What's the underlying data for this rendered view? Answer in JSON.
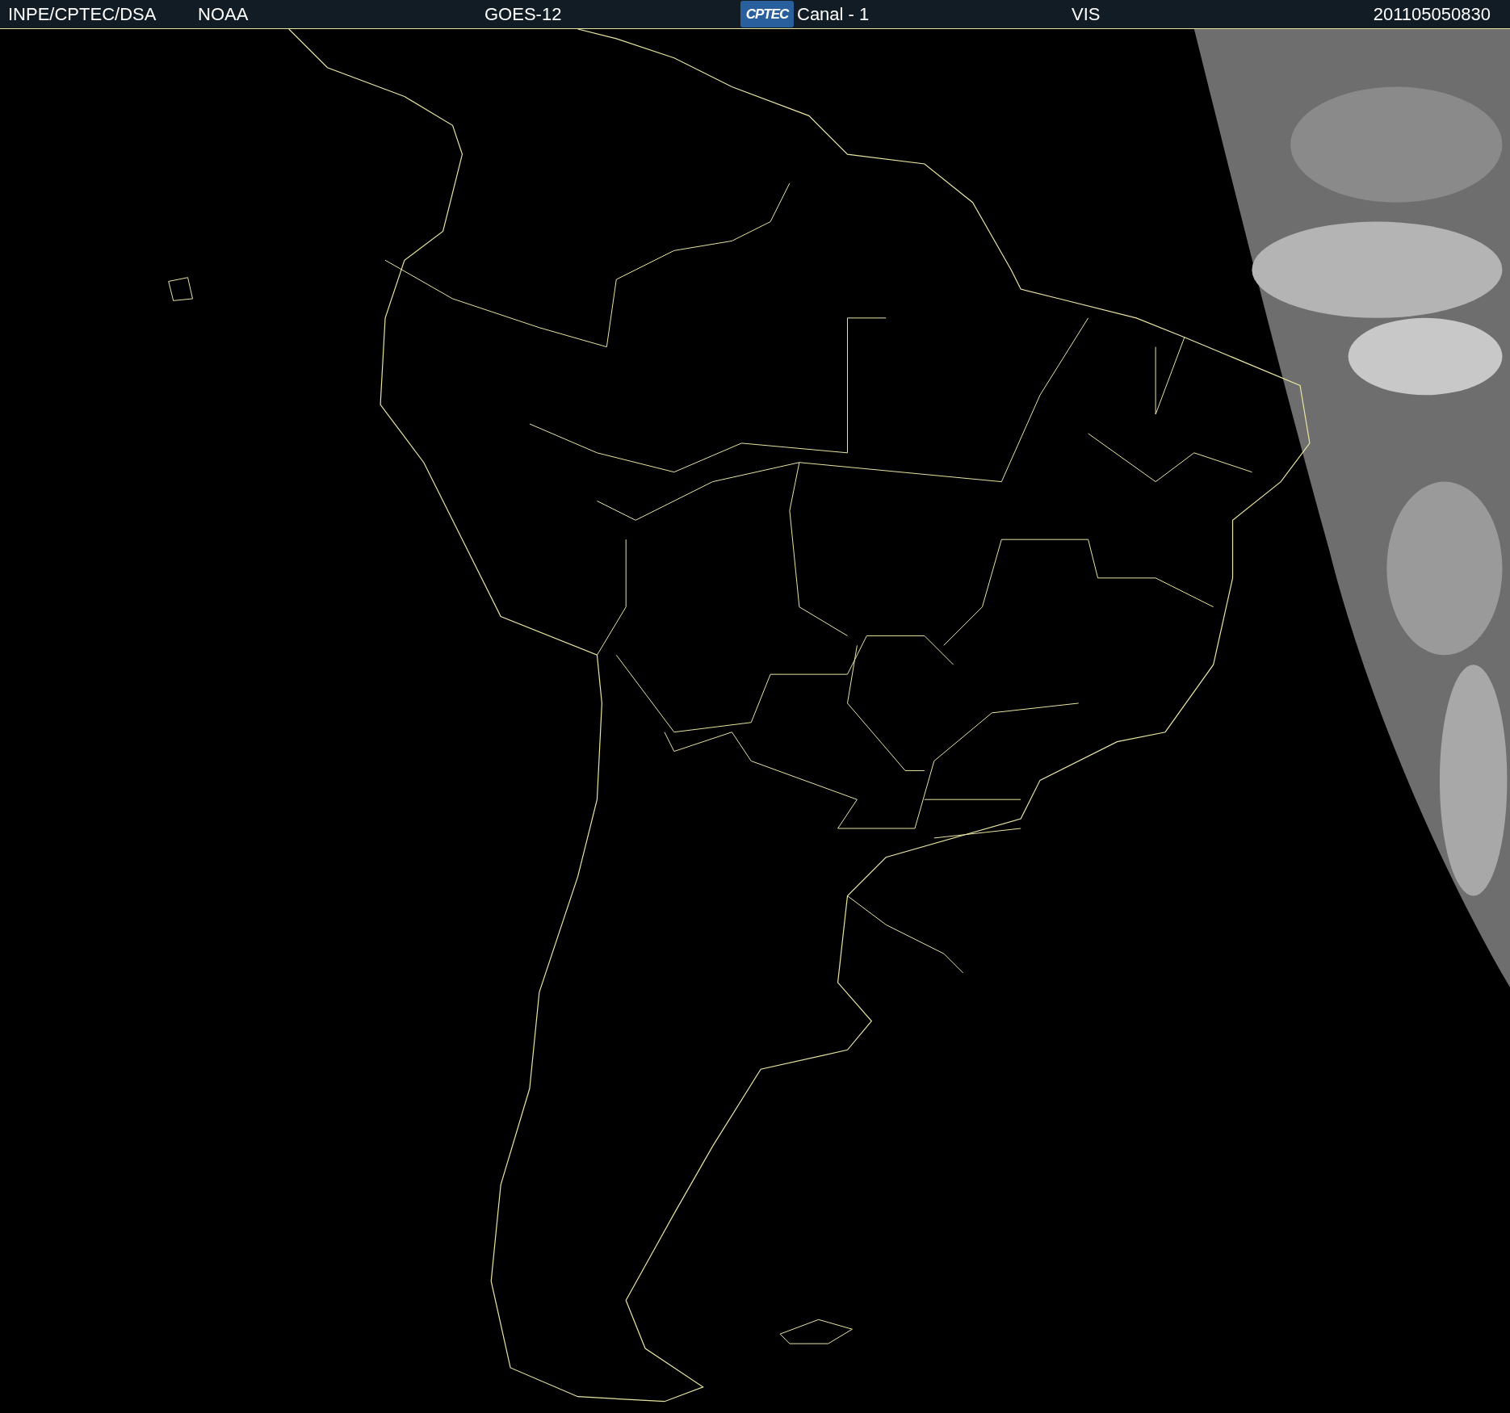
{
  "header": {
    "items": [
      "INPE/CPTEC/DSA",
      "NOAA",
      "GOES-12"
    ],
    "logo_text": "CPTEC",
    "items_after_logo": [
      "Canal - 1",
      "VIS",
      "201105050830"
    ]
  }
}
